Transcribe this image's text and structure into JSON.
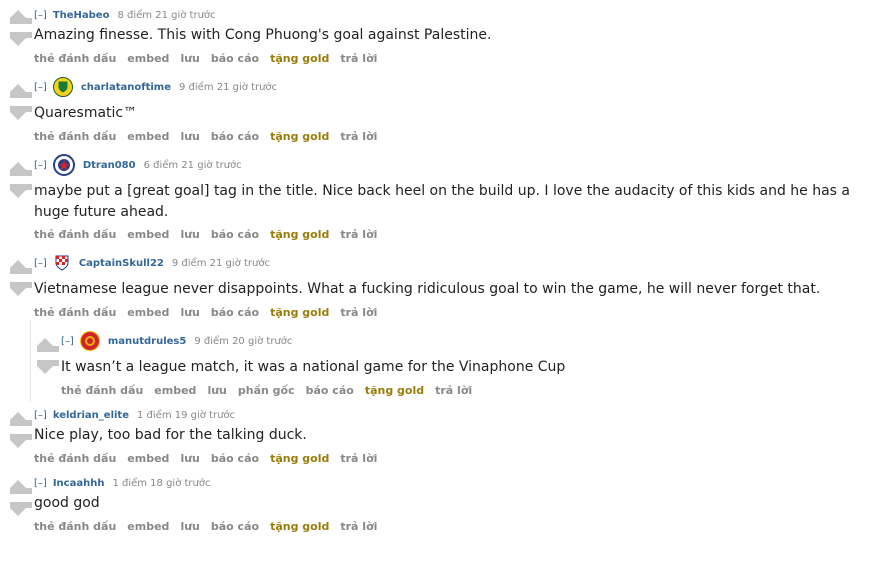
{
  "collapse_label": "[–]",
  "buttons": {
    "save_tag": "thẻ đánh dấu",
    "embed": "embed",
    "save": "lưu",
    "report": "báo cáo",
    "gold": "tặng gold",
    "reply": "trả lời",
    "parent": "phần gốc"
  },
  "comments": [
    {
      "author": "TheHabeo",
      "score": "8 điểm 21 giờ trước",
      "text": "Amazing finesse. This with Cong Phuong's goal against Palestine.",
      "flair": null
    },
    {
      "author": "charlatanoftime",
      "score": "9 điểm 21 giờ trước",
      "text": "Quaresmatic™",
      "flair": "club-crest-green"
    },
    {
      "author": "Dtran080",
      "score": "6 điểm 21 giờ trước",
      "text": "maybe put a [great goal] tag in the title. Nice back heel on the build up. I love the audacity of this kids and he has a huge future ahead.",
      "flair": "club-crest-navy"
    },
    {
      "author": "CaptainSkull22",
      "score": "9 điểm 21 giờ trước",
      "text": "Vietnamese league never disappoints. What a fucking ridiculous goal to win the game, he will never forget that.",
      "flair": "croatia-crest"
    },
    {
      "author": "manutdrules5",
      "score": "9 điểm 20 giờ trước",
      "text": "It wasn’t a league match, it was a national game for the Vinaphone Cup",
      "flair": "man-utd-crest"
    },
    {
      "author": "keldrian_elite",
      "score": "1 điểm 19 giờ trước",
      "text": "Nice play, too bad for the talking duck.",
      "flair": null
    },
    {
      "author": "Incaahhh",
      "score": "1 điểm 18 giờ trước",
      "text": "good god",
      "flair": null
    }
  ]
}
